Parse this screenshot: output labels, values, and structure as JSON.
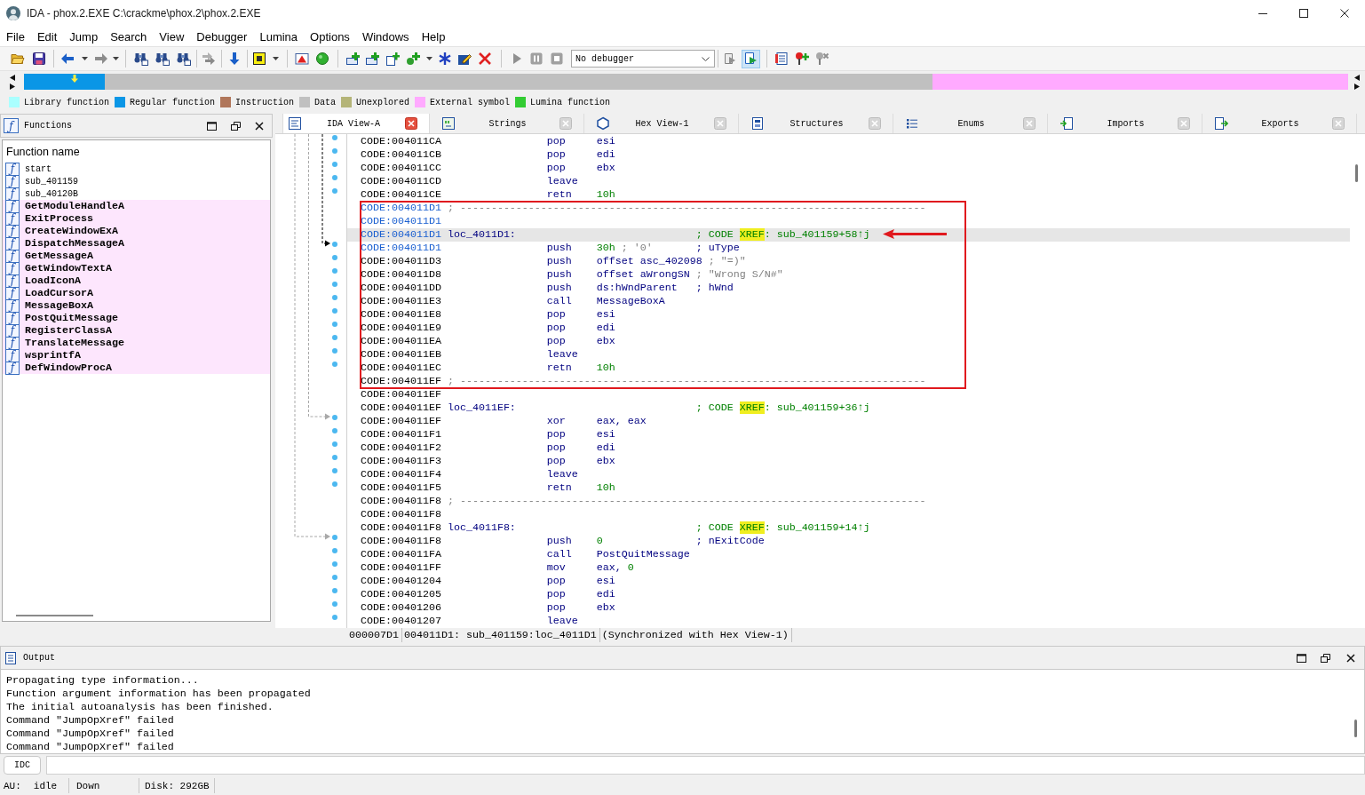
{
  "window": {
    "title": "IDA - phox.2.EXE C:\\crackme\\phox.2\\phox.2.EXE"
  },
  "menu": [
    "File",
    "Edit",
    "Jump",
    "Search",
    "View",
    "Debugger",
    "Lumina",
    "Options",
    "Windows",
    "Help"
  ],
  "toolbar": {
    "debugger": "No debugger",
    "toggles": [
      {
        "pressed": false
      },
      {
        "pressed": true
      }
    ]
  },
  "legend": [
    {
      "label": "Library function",
      "color": "#aaffff"
    },
    {
      "label": "Regular function",
      "color": "#0a96e6"
    },
    {
      "label": "Instruction",
      "color": "#b0765a"
    },
    {
      "label": "Data",
      "color": "#c0c0c0"
    },
    {
      "label": "Unexplored",
      "color": "#b4b478"
    },
    {
      "label": "External symbol",
      "color": "#ffaaff"
    },
    {
      "label": "Lumina function",
      "color": "#33cc33"
    }
  ],
  "functions": {
    "icon": "ƒ",
    "title": "Functions",
    "column": "Function name",
    "items": [
      {
        "icon": "ƒ",
        "name": "start",
        "kind": "regular"
      },
      {
        "icon": "ƒ",
        "name": "sub_401159",
        "kind": "regular"
      },
      {
        "icon": "ƒ",
        "name": "sub_40120B",
        "kind": "regular"
      },
      {
        "icon": "ƒ",
        "name": "GetModuleHandleA",
        "kind": "import"
      },
      {
        "icon": "ƒ",
        "name": "ExitProcess",
        "kind": "import"
      },
      {
        "icon": "ƒ",
        "name": "CreateWindowExA",
        "kind": "import"
      },
      {
        "icon": "ƒ",
        "name": "DispatchMessageA",
        "kind": "import"
      },
      {
        "icon": "ƒ",
        "name": "GetMessageA",
        "kind": "import"
      },
      {
        "icon": "ƒ",
        "name": "GetWindowTextA",
        "kind": "import"
      },
      {
        "icon": "ƒ",
        "name": "LoadIconA",
        "kind": "import"
      },
      {
        "icon": "ƒ",
        "name": "LoadCursorA",
        "kind": "import"
      },
      {
        "icon": "ƒ",
        "name": "MessageBoxA",
        "kind": "import"
      },
      {
        "icon": "ƒ",
        "name": "PostQuitMessage",
        "kind": "import"
      },
      {
        "icon": "ƒ",
        "name": "RegisterClassA",
        "kind": "import"
      },
      {
        "icon": "ƒ",
        "name": "TranslateMessage",
        "kind": "import"
      },
      {
        "icon": "ƒ",
        "name": "wsprintfA",
        "kind": "import"
      },
      {
        "icon": "ƒ",
        "name": "DefWindowProcA",
        "kind": "import"
      }
    ]
  },
  "tabs": [
    {
      "label": "IDA View-A",
      "selected": true
    },
    {
      "label": "Strings",
      "selected": false
    },
    {
      "label": "Hex View-1",
      "selected": false
    },
    {
      "label": "Structures",
      "selected": false
    },
    {
      "label": "Enums",
      "selected": false
    },
    {
      "label": "Imports",
      "selected": false
    },
    {
      "label": "Exports",
      "selected": false
    }
  ],
  "listing": {
    "lines": [
      {
        "kind": "instruction",
        "address": "CODE:004011CA",
        "current": false,
        "selected": false,
        "pointed": false,
        "mnemonic": "pop",
        "operands": [
          {
            "kind": "name",
            "text": "esi"
          }
        ]
      },
      {
        "kind": "instruction",
        "address": "CODE:004011CB",
        "current": false,
        "selected": false,
        "pointed": false,
        "mnemonic": "pop",
        "operands": [
          {
            "kind": "name",
            "text": "edi"
          }
        ]
      },
      {
        "kind": "instruction",
        "address": "CODE:004011CC",
        "current": false,
        "selected": false,
        "pointed": false,
        "mnemonic": "pop",
        "operands": [
          {
            "kind": "name",
            "text": "ebx"
          }
        ]
      },
      {
        "kind": "instruction",
        "address": "CODE:004011CD",
        "current": false,
        "selected": false,
        "pointed": false,
        "mnemonic": "leave"
      },
      {
        "kind": "instruction",
        "address": "CODE:004011CE",
        "current": false,
        "selected": false,
        "pointed": false,
        "mnemonic": "retn",
        "operands": [
          {
            "kind": "number",
            "text": "10h"
          }
        ]
      },
      {
        "kind": "annotation",
        "lines": [
          {
            "kind": "separator",
            "address": "CODE:004011D1",
            "current": true,
            "selected": false,
            "pointed": false,
            "text": "; ---------------------------------------------------------------------------"
          },
          {
            "kind": "blank",
            "address": "CODE:004011D1",
            "current": true,
            "selected": false,
            "pointed": false
          },
          {
            "kind": "label",
            "address": "CODE:004011D1",
            "current": true,
            "selected": true,
            "pointed": true,
            "label": "loc_4011D1:",
            "comment": [
              {
                "kind": "xref",
                "text": "; CODE ",
                "highlighted": false
              },
              {
                "kind": "xref",
                "text": "XREF",
                "highlighted": true
              },
              {
                "kind": "xref",
                "text": ": sub_401159+58↑j",
                "highlighted": false
              }
            ]
          },
          {
            "kind": "instruction",
            "address": "CODE:004011D1",
            "current": true,
            "selected": false,
            "pointed": false,
            "mnemonic": "push",
            "operands": [
              {
                "kind": "number",
                "text": "30h"
              },
              {
                "kind": "auto",
                "text": "; '0'"
              }
            ],
            "comment": [
              {
                "kind": "arg",
                "text": "; uType",
                "highlighted": false
              }
            ]
          },
          {
            "kind": "instruction",
            "address": "CODE:004011D3",
            "current": false,
            "selected": false,
            "pointed": false,
            "mnemonic": "push",
            "operands": [
              {
                "kind": "name",
                "text": "offset asc_402098"
              },
              {
                "kind": "auto",
                "text": "; \"=)\""
              }
            ]
          },
          {
            "kind": "instruction",
            "address": "CODE:004011D8",
            "current": false,
            "selected": false,
            "pointed": false,
            "mnemonic": "push",
            "operands": [
              {
                "kind": "name",
                "text": "offset aWrongSN"
              },
              {
                "kind": "auto",
                "text": "; \"Wrong S/N#\""
              }
            ]
          },
          {
            "kind": "instruction",
            "address": "CODE:004011DD",
            "current": false,
            "selected": false,
            "pointed": false,
            "mnemonic": "push",
            "operands": [
              {
                "kind": "name",
                "text": "ds:hWndParent"
              }
            ],
            "comment": [
              {
                "kind": "arg",
                "text": "; hWnd",
                "highlighted": false
              }
            ]
          },
          {
            "kind": "instruction",
            "address": "CODE:004011E3",
            "current": false,
            "selected": false,
            "pointed": false,
            "mnemonic": "call",
            "operands": [
              {
                "kind": "name",
                "text": "MessageBoxA"
              }
            ]
          },
          {
            "kind": "instruction",
            "address": "CODE:004011E8",
            "current": false,
            "selected": false,
            "pointed": false,
            "mnemonic": "pop",
            "operands": [
              {
                "kind": "name",
                "text": "esi"
              }
            ]
          },
          {
            "kind": "instruction",
            "address": "CODE:004011E9",
            "current": false,
            "selected": false,
            "pointed": false,
            "mnemonic": "pop",
            "operands": [
              {
                "kind": "name",
                "text": "edi"
              }
            ]
          },
          {
            "kind": "instruction",
            "address": "CODE:004011EA",
            "current": false,
            "selected": false,
            "pointed": false,
            "mnemonic": "pop",
            "operands": [
              {
                "kind": "name",
                "text": "ebx"
              }
            ]
          },
          {
            "kind": "instruction",
            "address": "CODE:004011EB",
            "current": false,
            "selected": false,
            "pointed": false,
            "mnemonic": "leave"
          },
          {
            "kind": "instruction",
            "address": "CODE:004011EC",
            "current": false,
            "selected": false,
            "pointed": false,
            "mnemonic": "retn",
            "operands": [
              {
                "kind": "number",
                "text": "10h"
              }
            ]
          },
          {
            "kind": "separator",
            "address": "CODE:004011EF",
            "current": false,
            "selected": false,
            "pointed": false,
            "text": "; ---------------------------------------------------------------------------"
          }
        ]
      },
      {
        "kind": "blank",
        "address": "CODE:004011EF",
        "current": false,
        "selected": false,
        "pointed": false
      },
      {
        "kind": "label",
        "address": "CODE:004011EF",
        "current": false,
        "selected": false,
        "pointed": false,
        "label": "loc_4011EF:",
        "comment": [
          {
            "kind": "xref",
            "text": "; CODE ",
            "highlighted": false
          },
          {
            "kind": "xref",
            "text": "XREF",
            "highlighted": true
          },
          {
            "kind": "xref",
            "text": ": sub_401159+36↑j",
            "highlighted": false
          }
        ]
      },
      {
        "kind": "instruction",
        "address": "CODE:004011EF",
        "current": false,
        "selected": false,
        "pointed": false,
        "mnemonic": "xor",
        "operands": [
          {
            "kind": "name",
            "text": "eax, eax"
          }
        ]
      },
      {
        "kind": "instruction",
        "address": "CODE:004011F1",
        "current": false,
        "selected": false,
        "pointed": false,
        "mnemonic": "pop",
        "operands": [
          {
            "kind": "name",
            "text": "esi"
          }
        ]
      },
      {
        "kind": "instruction",
        "address": "CODE:004011F2",
        "current": false,
        "selected": false,
        "pointed": false,
        "mnemonic": "pop",
        "operands": [
          {
            "kind": "name",
            "text": "edi"
          }
        ]
      },
      {
        "kind": "instruction",
        "address": "CODE:004011F3",
        "current": false,
        "selected": false,
        "pointed": false,
        "mnemonic": "pop",
        "operands": [
          {
            "kind": "name",
            "text": "ebx"
          }
        ]
      },
      {
        "kind": "instruction",
        "address": "CODE:004011F4",
        "current": false,
        "selected": false,
        "pointed": false,
        "mnemonic": "leave"
      },
      {
        "kind": "instruction",
        "address": "CODE:004011F5",
        "current": false,
        "selected": false,
        "pointed": false,
        "mnemonic": "retn",
        "operands": [
          {
            "kind": "number",
            "text": "10h"
          }
        ]
      },
      {
        "kind": "separator",
        "address": "CODE:004011F8",
        "current": false,
        "selected": false,
        "pointed": false,
        "text": "; ---------------------------------------------------------------------------"
      },
      {
        "kind": "blank",
        "address": "CODE:004011F8",
        "current": false,
        "selected": false,
        "pointed": false
      },
      {
        "kind": "label",
        "address": "CODE:004011F8",
        "current": false,
        "selected": false,
        "pointed": false,
        "label": "loc_4011F8:",
        "comment": [
          {
            "kind": "xref",
            "text": "; CODE ",
            "highlighted": false
          },
          {
            "kind": "xref",
            "text": "XREF",
            "highlighted": true
          },
          {
            "kind": "xref",
            "text": ": sub_401159+14↑j",
            "highlighted": false
          }
        ]
      },
      {
        "kind": "instruction",
        "address": "CODE:004011F8",
        "current": false,
        "selected": false,
        "pointed": false,
        "mnemonic": "push",
        "operands": [
          {
            "kind": "number",
            "text": "0"
          }
        ],
        "comment": [
          {
            "kind": "arg",
            "text": "; nExitCode",
            "highlighted": false
          }
        ]
      },
      {
        "kind": "instruction",
        "address": "CODE:004011FA",
        "current": false,
        "selected": false,
        "pointed": false,
        "mnemonic": "call",
        "operands": [
          {
            "kind": "name",
            "text": "PostQuitMessage"
          }
        ]
      },
      {
        "kind": "instruction",
        "address": "CODE:004011FF",
        "current": false,
        "selected": false,
        "pointed": false,
        "mnemonic": "mov",
        "operands": [
          {
            "kind": "name",
            "text": "eax,"
          },
          {
            "kind": "number",
            "text": "0"
          }
        ]
      },
      {
        "kind": "instruction",
        "address": "CODE:00401204",
        "current": false,
        "selected": false,
        "pointed": false,
        "mnemonic": "pop",
        "operands": [
          {
            "kind": "name",
            "text": "esi"
          }
        ]
      },
      {
        "kind": "instruction",
        "address": "CODE:00401205",
        "current": false,
        "selected": false,
        "pointed": false,
        "mnemonic": "pop",
        "operands": [
          {
            "kind": "name",
            "text": "edi"
          }
        ]
      },
      {
        "kind": "instruction",
        "address": "CODE:00401206",
        "current": false,
        "selected": false,
        "pointed": false,
        "mnemonic": "pop",
        "operands": [
          {
            "kind": "name",
            "text": "ebx"
          }
        ]
      },
      {
        "kind": "instruction",
        "address": "CODE:00401207",
        "current": false,
        "selected": false,
        "pointed": false,
        "mnemonic": "leave"
      }
    ],
    "status": [
      "000007D1",
      "004011D1: sub_401159:loc_4011D1",
      "(Synchronized with Hex View-1)"
    ]
  },
  "output": {
    "title": "Output",
    "lines": [
      "Propagating type information...",
      "Function argument information has been propagated",
      "The initial autoanalysis has been finished.",
      "Command \"JumpOpXref\" failed",
      "Command \"JumpOpXref\" failed",
      "Command \"JumpOpXref\" failed"
    ],
    "command_language": "IDC"
  },
  "status_bar": {
    "au_label": "AU:",
    "au_state": "idle",
    "direction": "Down",
    "disk": "Disk: 292GB"
  }
}
